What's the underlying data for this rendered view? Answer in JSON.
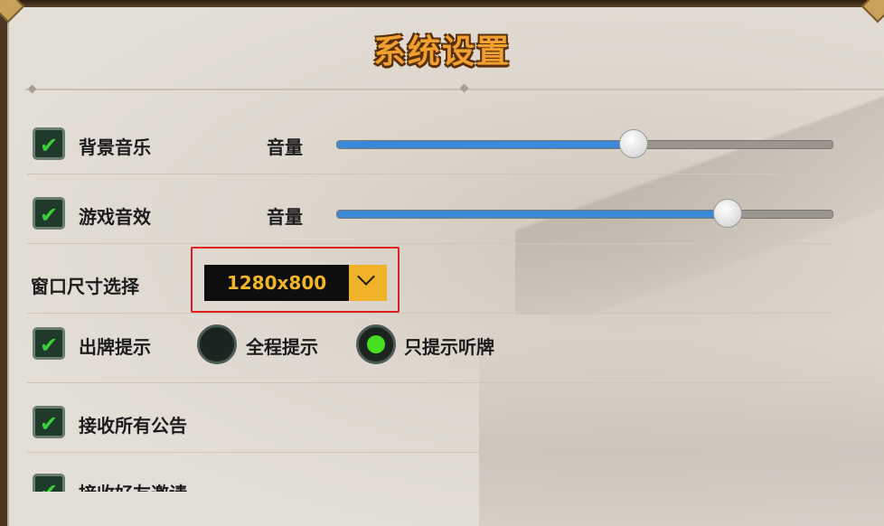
{
  "dialog": {
    "title": "系统设置"
  },
  "settings": {
    "bgm": {
      "label": "背景音乐",
      "checked": true,
      "volume_label": "音量",
      "volume": 0.6
    },
    "sfx": {
      "label": "游戏音效",
      "checked": true,
      "volume_label": "音量",
      "volume": 0.79
    },
    "window_size": {
      "label": "窗口尺寸选择",
      "value": "1280x800"
    },
    "play_hint": {
      "label": "出牌提示",
      "checked": true,
      "options": [
        {
          "label": "全程提示",
          "selected": false
        },
        {
          "label": "只提示听牌",
          "selected": true
        }
      ]
    },
    "announcements": {
      "label": "接收所有公告",
      "checked": true
    },
    "friend_invite": {
      "label": "接收好友邀请",
      "checked": true
    }
  },
  "colors": {
    "title": "#f0a030",
    "slider_fill": "#3a8ad8",
    "check_green": "#3ccf3c",
    "select_accent": "#f0b228",
    "highlight_border": "#e02020"
  }
}
